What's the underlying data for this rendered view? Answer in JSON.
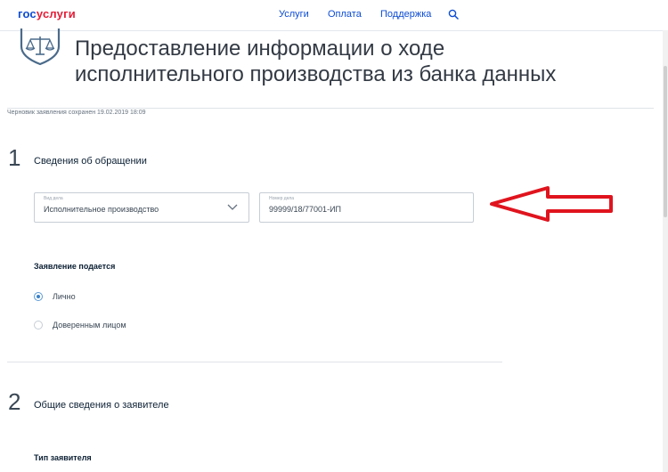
{
  "header": {
    "logo_part1": "гос",
    "logo_part2": "услуги",
    "nav": [
      "Услуги",
      "Оплата",
      "Поддержка"
    ],
    "search_icon": "search-icon"
  },
  "page": {
    "title_line1": "Предоставление информации о ходе",
    "title_line2": "исполнительного производства из банка данных",
    "draft_note": "Черновик заявления сохранен 19.02.2019 18:09"
  },
  "step1": {
    "number": "1",
    "title": "Сведения об обращении",
    "case_type": {
      "label": "Вид дела",
      "value": "Исполнительное производство"
    },
    "case_number": {
      "label": "Номер дела",
      "value": "99999/18/77001-ИП"
    },
    "submission_label": "Заявление подается",
    "options": [
      {
        "label": "Лично",
        "selected": true
      },
      {
        "label": "Доверенным лицом",
        "selected": false
      }
    ]
  },
  "step2": {
    "number": "2",
    "title": "Общие сведения о заявителе",
    "applicant_type_label": "Тип заявителя"
  },
  "colors": {
    "brand_blue": "#0d4cd3",
    "brand_red": "#e41d37",
    "annotation_red": "#e0141e",
    "radio_selected": "#3a82c8"
  }
}
